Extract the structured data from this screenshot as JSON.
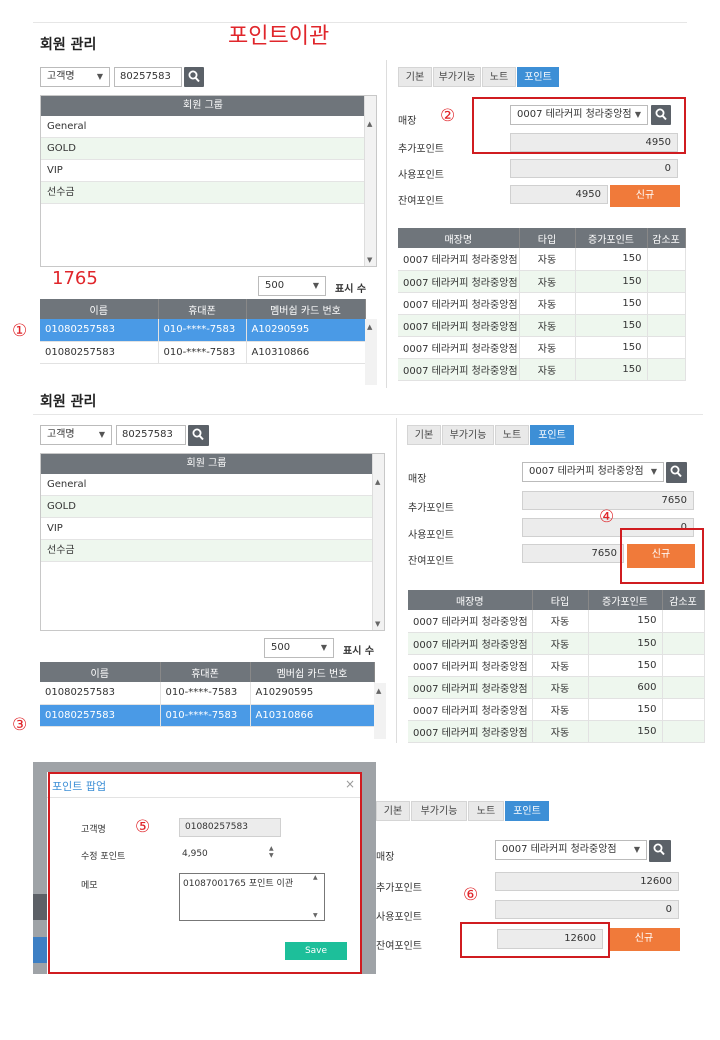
{
  "annotation_title": "포인트이관",
  "annotation_number": "1765",
  "markers": {
    "m1": "①",
    "m2": "②",
    "m3": "③",
    "m4": "④",
    "m5": "⑤",
    "m6": "⑥"
  },
  "common": {
    "header": "회원 관리",
    "search_type": "고객명",
    "search_value": "80257583",
    "group_header": "회원 그룹",
    "groups": [
      "General",
      "GOLD",
      "VIP",
      "선수금"
    ],
    "page_size": "500",
    "page_size_label": "표시 수",
    "member_cols": [
      "이름",
      "휴대폰",
      "멤버쉽 카드 번호"
    ],
    "members": [
      [
        "01080257583",
        "010-****-7583",
        "A10290595"
      ],
      [
        "01080257583",
        "010-****-7583",
        "A10310866"
      ]
    ],
    "tabs": [
      "기본",
      "부가기능",
      "노트",
      "포인트"
    ],
    "store_label": "매장",
    "store_value": "0007 테라커피 청라중앙점",
    "add_label": "추가포인트",
    "use_label": "사용포인트",
    "remain_label": "잔여포인트",
    "new_btn": "신규",
    "hist_cols": [
      "매장명",
      "타입",
      "증가포인트",
      "감소포"
    ],
    "hist_store": "0007 테라커피 청라중앙점",
    "hist_type": "자동"
  },
  "panel1": {
    "add": "4950",
    "use": "0",
    "remain": "4950",
    "hist_values": [
      "150",
      "150",
      "150",
      "150",
      "150",
      "150"
    ]
  },
  "panel2": {
    "add": "7650",
    "use": "0",
    "remain": "7650",
    "hist_values": [
      "150",
      "150",
      "150",
      "600",
      "150",
      "150"
    ]
  },
  "popup": {
    "title": "포인트 팝업",
    "close": "×",
    "customer_label": "고객명",
    "customer_value": "01080257583",
    "point_label": "수정 포인트",
    "point_value": "4,950",
    "memo_label": "메모",
    "memo_value": "01087001765 포인트 이관",
    "save": "Save"
  },
  "panel3": {
    "add": "12600",
    "use": "0",
    "remain": "12600"
  },
  "colors": {
    "accent_blue": "#3d8fd6",
    "orange": "#f07a3a",
    "annotation_red": "#e0262b",
    "save_green": "#1dbf9a"
  }
}
